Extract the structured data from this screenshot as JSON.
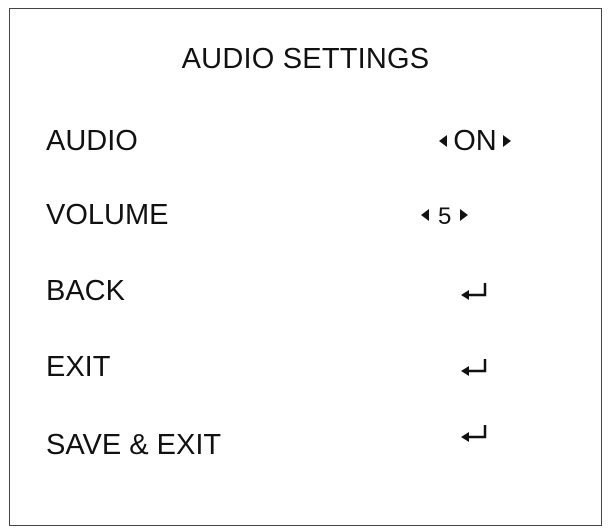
{
  "menu": {
    "title": "AUDIO SETTINGS",
    "items": [
      {
        "label": "AUDIO",
        "control": "selector",
        "value": "ON",
        "icon_left": "triangle-left-icon",
        "icon_right": "triangle-right-icon"
      },
      {
        "label": "VOLUME",
        "control": "selector",
        "value": "5",
        "icon_left": "triangle-left-icon",
        "icon_right": "triangle-right-icon"
      },
      {
        "label": "BACK",
        "control": "enter",
        "icon": "enter-return-icon"
      },
      {
        "label": "EXIT",
        "control": "enter",
        "icon": "enter-return-icon"
      },
      {
        "label": "SAVE & EXIT",
        "control": "enter",
        "icon": "enter-return-icon"
      }
    ]
  },
  "colors": {
    "text": "#111111",
    "border": "#444444",
    "background": "#ffffff"
  }
}
